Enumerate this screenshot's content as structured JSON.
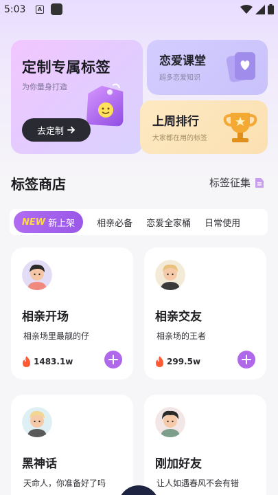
{
  "status_bar": {
    "time": "5:03",
    "a_label": "A"
  },
  "banner": {
    "main": {
      "title": "定制专属标签",
      "subtitle": "为你量身打造",
      "button": "去定制"
    },
    "course": {
      "title": "恋爱课堂",
      "subtitle": "超多恋爱知识"
    },
    "ranking": {
      "title": "上周排行",
      "subtitle": "大家都在用的标签"
    }
  },
  "section": {
    "title": "标签商店",
    "more": "标签征集"
  },
  "tabs": {
    "new_badge": "NEW",
    "active": "新上架",
    "items": [
      "相亲必备",
      "恋爱全家桶",
      "日常使用"
    ]
  },
  "cards": [
    {
      "title": "相亲开场",
      "desc": "相亲场里最靓的仔",
      "count": "1483.1w"
    },
    {
      "title": "相亲交友",
      "desc": "相亲场的王者",
      "count": "299.5w"
    },
    {
      "title": "黑神话",
      "desc": "天命人，你准备好了吗"
    },
    {
      "title": "刚加好友",
      "desc": "让人如遇春风不会有错"
    }
  ],
  "colors": {
    "accent": "#b068ea",
    "flame": "#ff5a36",
    "gold": "#f2a531"
  },
  "icons": [
    "wifi-icon",
    "signal-icon",
    "battery-icon",
    "arrow-right-icon",
    "heart-card-icon",
    "trophy-icon",
    "tag-icon",
    "document-icon",
    "flame-icon",
    "plus-icon"
  ]
}
